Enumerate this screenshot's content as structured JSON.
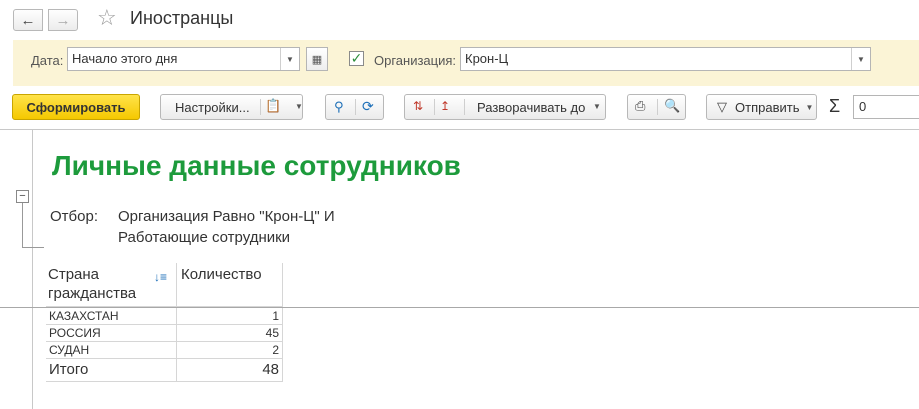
{
  "header": {
    "back_icon": "arrow-left-icon",
    "forward_icon": "arrow-right-icon",
    "title": "Иностранцы"
  },
  "filters": {
    "date_label": "Дата:",
    "date_value": "Начало этого дня",
    "org_label": "Организация:",
    "org_value": "Крон-Ц",
    "org_checked": true
  },
  "toolbar": {
    "generate_label": "Сформировать",
    "settings_label": "Настройки...",
    "expand_label": "Разворачивать до",
    "send_label": "Отправить",
    "sum_symbol": "Σ",
    "sum_value": "0"
  },
  "report": {
    "title": "Личные данные сотрудников",
    "selection_label": "Отбор:",
    "selection_line1": "Организация Равно \"Крон-Ц\" И",
    "selection_line2": "Работающие сотрудники",
    "col_country_line1": "Страна",
    "col_country_line2": "гражданства",
    "col_count": "Количество",
    "rows": [
      {
        "country": "КАЗАХСТАН",
        "count": "1"
      },
      {
        "country": "РОССИЯ",
        "count": "45"
      },
      {
        "country": "СУДАН",
        "count": "2"
      }
    ],
    "total_label": "Итого",
    "total_value": "48"
  },
  "colors": {
    "accent_yellow": "#f5c800",
    "title_green": "#1d9b3c",
    "filter_bg": "#fbf4d6"
  }
}
